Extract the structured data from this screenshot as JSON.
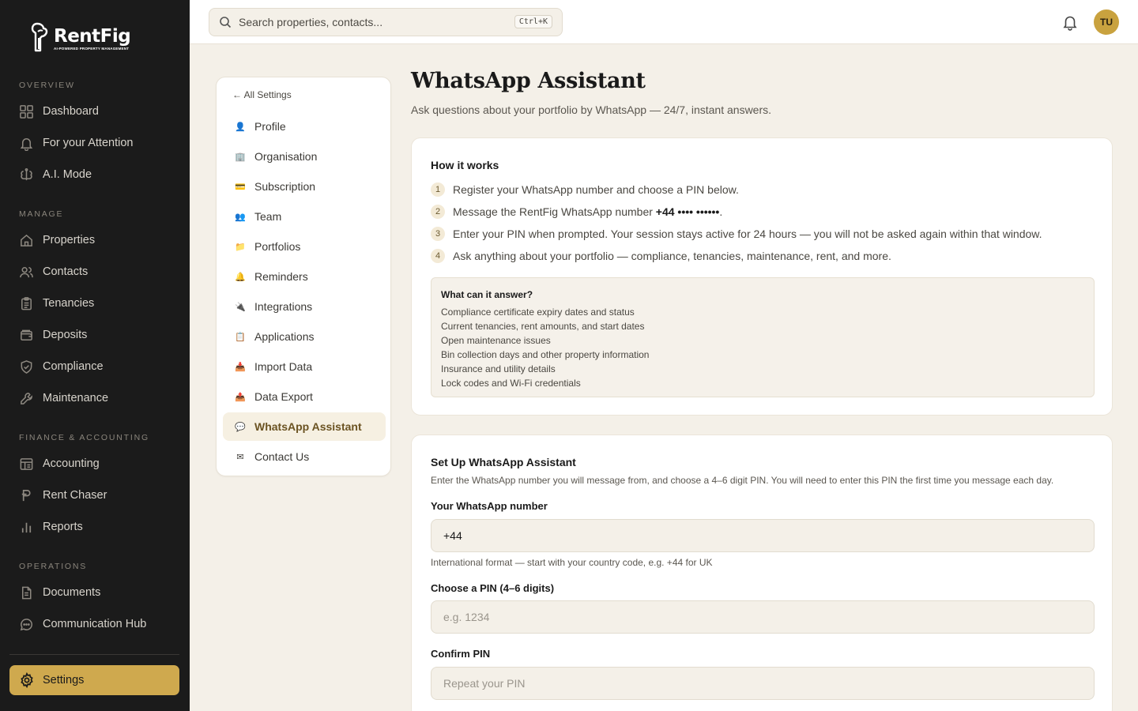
{
  "brand": {
    "name": "RentFig",
    "tagline": "AI-POWERED PROPERTY MANAGEMENT"
  },
  "colors": {
    "sidebar": "#1b1b1b",
    "accent": "#cfa94e",
    "background": "#f4f0e8"
  },
  "sidebar": {
    "sections": {
      "overview": "OVERVIEW",
      "manage": "MANAGE",
      "finance": "FINANCE & ACCOUNTING",
      "operations": "OPERATIONS"
    },
    "items": {
      "dashboard": "Dashboard",
      "attention": "For your Attention",
      "ai_mode": "A.I. Mode",
      "properties": "Properties",
      "contacts": "Contacts",
      "tenancies": "Tenancies",
      "deposits": "Deposits",
      "compliance": "Compliance",
      "maintenance": "Maintenance",
      "accounting": "Accounting",
      "rent_chaser": "Rent Chaser",
      "reports": "Reports",
      "documents": "Documents",
      "communication_hub": "Communication Hub"
    },
    "settings_label": "Settings"
  },
  "topbar": {
    "search_placeholder": "Search properties, contacts...",
    "search_shortcut": "Ctrl+K",
    "user_initials": "TU"
  },
  "settings_menu": {
    "back_label": "← All Settings",
    "items": [
      {
        "label": "Profile",
        "icon": "👤"
      },
      {
        "label": "Organisation",
        "icon": "🏢"
      },
      {
        "label": "Subscription",
        "icon": "💳"
      },
      {
        "label": "Team",
        "icon": "👥"
      },
      {
        "label": "Portfolios",
        "icon": "📁"
      },
      {
        "label": "Reminders",
        "icon": "🔔"
      },
      {
        "label": "Integrations",
        "icon": "🔌"
      },
      {
        "label": "Applications",
        "icon": "📋"
      },
      {
        "label": "Import Data",
        "icon": "📥"
      },
      {
        "label": "Data Export",
        "icon": "📤"
      },
      {
        "label": "WhatsApp Assistant",
        "icon": "💬"
      },
      {
        "label": "Contact Us",
        "icon": "✉"
      }
    ]
  },
  "page": {
    "title": "WhatsApp Assistant",
    "subtitle": "Ask questions about your portfolio by WhatsApp — 24/7, instant answers."
  },
  "how_it_works": {
    "title": "How it works",
    "steps": [
      {
        "num": "1",
        "text": "Register your WhatsApp number and choose a PIN below."
      },
      {
        "num": "2",
        "text_before": "Message the RentFig WhatsApp number ",
        "text_bold": "+44 •••• ••••••",
        "text_after": "."
      },
      {
        "num": "3",
        "text": "Enter your PIN when prompted. Your session stays active for 24 hours — you will not be asked again within that window."
      },
      {
        "num": "4",
        "text": "Ask anything about your portfolio — compliance, tenancies, maintenance, rent, and more."
      }
    ],
    "answers_title": "What can it answer?",
    "answers": [
      "Compliance certificate expiry dates and status",
      "Current tenancies, rent amounts, and start dates",
      "Open maintenance issues",
      "Bin collection days and other property information",
      "Insurance and utility details",
      "Lock codes and Wi-Fi credentials"
    ]
  },
  "setup": {
    "title": "Set Up WhatsApp Assistant",
    "description": "Enter the WhatsApp number you will message from, and choose a 4–6 digit PIN. You will need to enter this PIN the first time you message each day.",
    "number_label": "Your WhatsApp number",
    "number_value": "+44",
    "number_help": "International format — start with your country code, e.g. +44 for UK",
    "pin_label": "Choose a PIN (4–6 digits)",
    "pin_placeholder": "e.g. 1234",
    "confirm_label": "Confirm PIN",
    "confirm_placeholder": "Repeat your PIN"
  }
}
